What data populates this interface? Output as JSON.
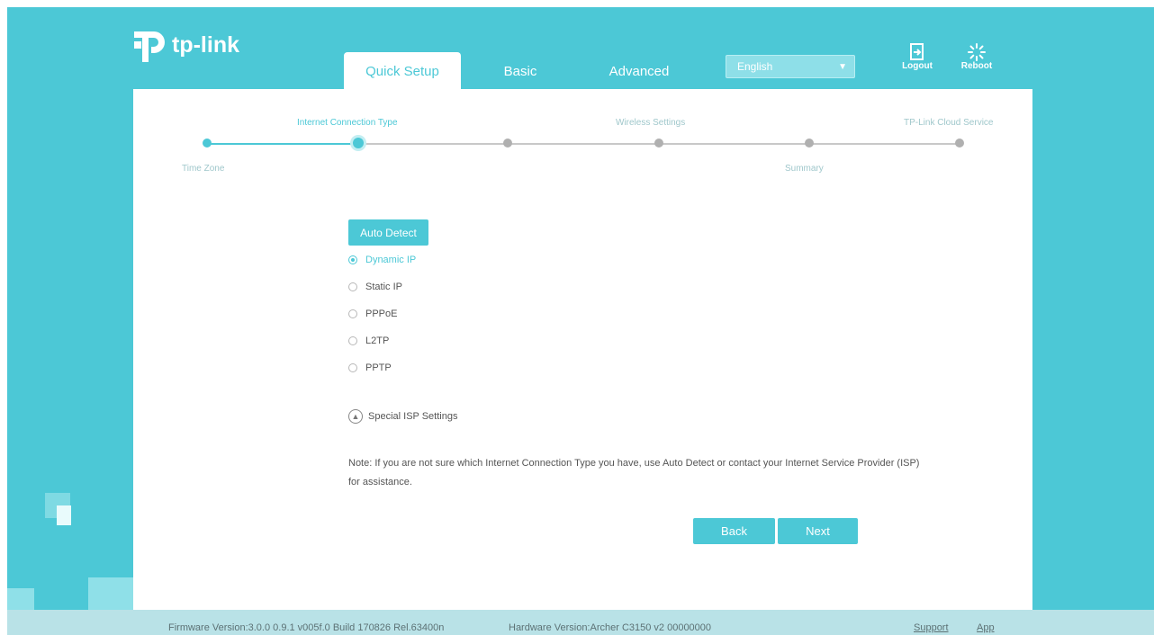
{
  "brand": {
    "name": "tp-link"
  },
  "nav": {
    "tabs": [
      {
        "label": "Quick Setup",
        "active": true
      },
      {
        "label": "Basic",
        "active": false
      },
      {
        "label": "Advanced",
        "active": false
      }
    ],
    "language": "English",
    "logout": "Logout",
    "reboot": "Reboot"
  },
  "steps": {
    "top": [
      "Internet Connection Type",
      "Wireless Settings",
      "TP-Link Cloud Service"
    ],
    "bottom": [
      "Time Zone",
      "Summary"
    ],
    "current": "Internet Connection Type"
  },
  "form": {
    "auto_detect": "Auto Detect",
    "options": [
      {
        "label": "Dynamic IP",
        "checked": true
      },
      {
        "label": "Static IP",
        "checked": false
      },
      {
        "label": "PPPoE",
        "checked": false
      },
      {
        "label": "L2TP",
        "checked": false
      },
      {
        "label": "PPTP",
        "checked": false
      }
    ],
    "special_isp": "Special ISP Settings",
    "note_line1": "Note: If you are not sure which Internet Connection Type you have, use Auto Detect or contact your Internet Service Provider (ISP)",
    "note_line2": "for assistance.",
    "back": "Back",
    "next": "Next"
  },
  "footer": {
    "firmware": "Firmware Version:3.0.0 0.9.1 v005f.0 Build 170826 Rel.63400n",
    "hardware": "Hardware Version:Archer C3150 v2 00000000",
    "support": "Support",
    "app": "App"
  },
  "colors": {
    "accent": "#4cc8d6",
    "background": "#4cc8d6",
    "panel": "#ffffff"
  }
}
